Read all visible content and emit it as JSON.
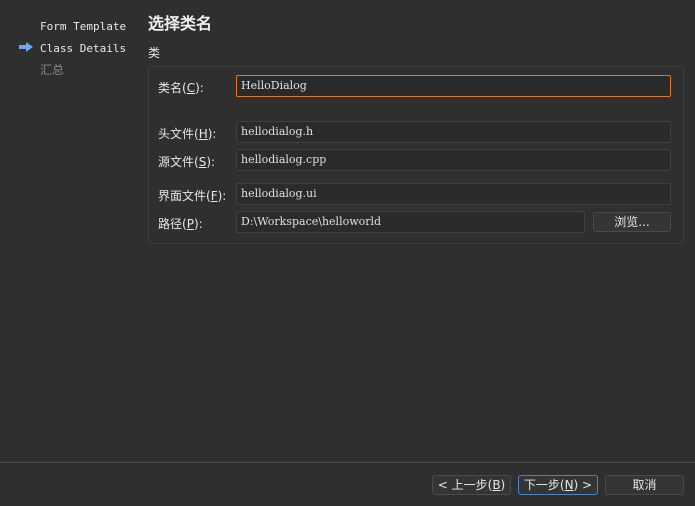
{
  "sidebar": {
    "steps": [
      {
        "label": "Form Template"
      },
      {
        "label": "Class Details"
      },
      {
        "label": "汇总"
      }
    ]
  },
  "page": {
    "title": "选择类名",
    "group_title": "类"
  },
  "form": {
    "class_name": {
      "label_pre": "类名(",
      "mnemonic": "C",
      "label_post": "):",
      "value": "HelloDialog"
    },
    "header_file": {
      "label_pre": "头文件(",
      "mnemonic": "H",
      "label_post": "):",
      "value": "hellodialog.h"
    },
    "source_file": {
      "label_pre": "源文件(",
      "mnemonic": "S",
      "label_post": "):",
      "value": "hellodialog.cpp"
    },
    "form_file": {
      "label_pre": "界面文件(",
      "mnemonic": "F",
      "label_post": "):",
      "value": "hellodialog.ui"
    },
    "path": {
      "label_pre": "路径(",
      "mnemonic": "P",
      "label_post": "):",
      "value": "D:\\Workspace\\helloworld"
    },
    "browse_label": "浏览..."
  },
  "footer": {
    "back": {
      "label_pre": "< 上一步(",
      "mnemonic": "B",
      "label_post": ")"
    },
    "next": {
      "label_pre": "下一步(",
      "mnemonic": "N",
      "label_post": ") >"
    },
    "cancel_label": "取消"
  },
  "colors": {
    "background": "#2f2f2f",
    "focus_border": "#e07a1f",
    "primary_button_border": "#4a82c8",
    "current_step_arrow": "#6fa8e8"
  }
}
